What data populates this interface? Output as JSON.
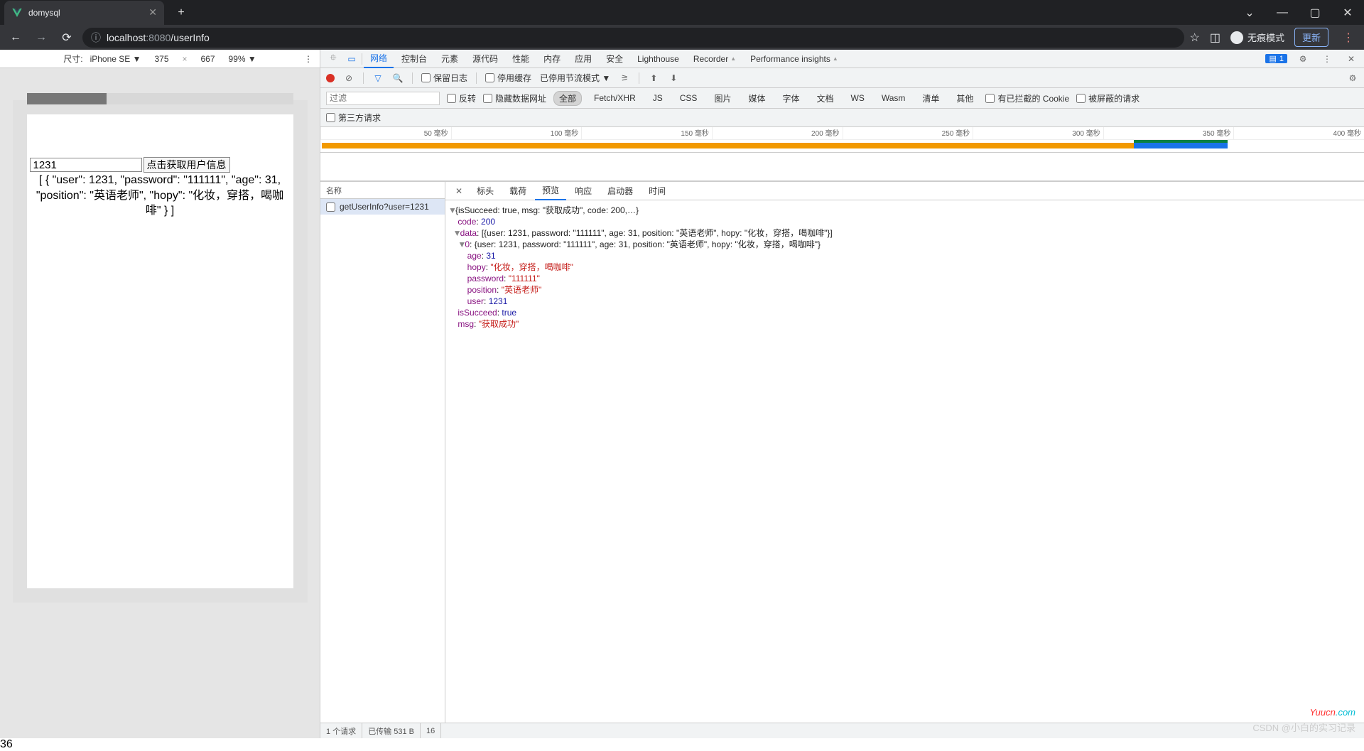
{
  "browser": {
    "tab_title": "domysql",
    "url_host": "localhost",
    "url_port": ":8080",
    "url_path": "/userInfo",
    "incognito_label": "无痕模式",
    "update_label": "更新"
  },
  "device_toolbar": {
    "label_dim": "尺寸:",
    "device": "iPhone SE",
    "width": "375",
    "height": "667",
    "zoom": "99%"
  },
  "app": {
    "input_value": "1231",
    "button_label": "点击获取用户信息",
    "output_text": "[ { \"user\": 1231, \"password\": \"111111\", \"age\": 31, \"position\": \"英语老师\", \"hopy\": \"化妆，穿搭，喝咖啡\" } ]"
  },
  "devtools": {
    "tabs": [
      "网络",
      "控制台",
      "元素",
      "源代码",
      "性能",
      "内存",
      "应用",
      "安全",
      "Lighthouse",
      "Recorder",
      "Performance insights"
    ],
    "issues_count": "1",
    "toolbar": {
      "preserve_log": "保留日志",
      "disable_cache": "停用缓存",
      "throttle": "已停用节流模式"
    },
    "filters": {
      "placeholder": "过滤",
      "invert": "反转",
      "hide_data_urls": "隐藏数据网址",
      "all": "全部",
      "types": [
        "Fetch/XHR",
        "JS",
        "CSS",
        "图片",
        "媒体",
        "字体",
        "文档",
        "WS",
        "Wasm",
        "清单",
        "其他"
      ],
      "blocked_cookies": "有已拦截的 Cookie",
      "blocked_requests": "被屏蔽的请求",
      "third_party": "第三方请求"
    },
    "timeline_ticks": [
      "50 毫秒",
      "100 毫秒",
      "150 毫秒",
      "200 毫秒",
      "250 毫秒",
      "300 毫秒",
      "350 毫秒",
      "400 毫秒"
    ],
    "request_list": {
      "header": "名称",
      "items": [
        "getUserInfo?user=1231"
      ]
    },
    "detail_tabs": [
      "标头",
      "载荷",
      "预览",
      "响应",
      "启动器",
      "时间"
    ],
    "status": {
      "requests": "1 个请求",
      "transferred": "已传输 531 B",
      "resources": "16"
    }
  },
  "preview_json": {
    "summary": "{isSucceed: true, msg: \"获取成功\", code: 200,…}",
    "code": 200,
    "data_summary": "[{user: 1231, password: \"111111\", age: 31, position: \"英语老师\", hopy: \"化妆，穿搭，喝咖啡\"}]",
    "item0_summary": "{user: 1231, password: \"111111\", age: 31, position: \"英语老师\", hopy: \"化妆，穿搭，喝咖啡\"}",
    "item0": {
      "age": 31,
      "hopy": "化妆，穿搭，喝咖啡",
      "password": "111111",
      "position": "英语老师",
      "user": 1231
    },
    "isSucceed": "true",
    "msg": "获取成功"
  },
  "watermarks": {
    "yuucn": "Yuucn",
    "yuucn_tld": ".com",
    "csdn": "CSDN @小白的实习记录"
  }
}
